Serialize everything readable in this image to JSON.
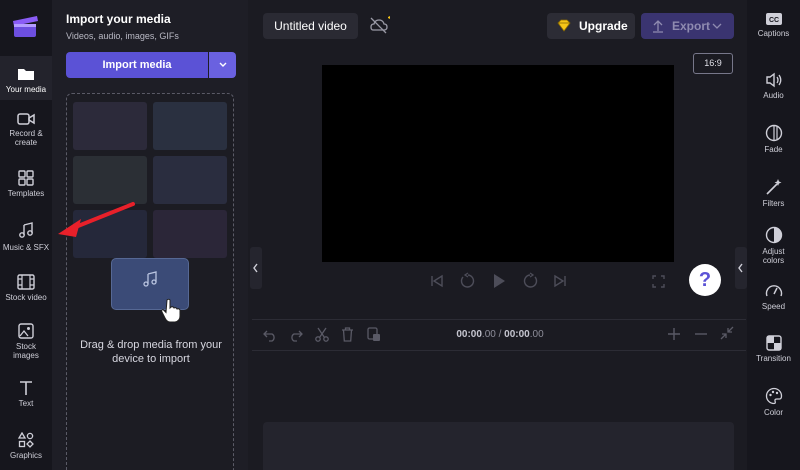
{
  "left_nav": {
    "items": [
      {
        "label": "Your media",
        "icon": "folder-icon",
        "active": true
      },
      {
        "label": "Record & create",
        "icon": "video-camera-icon"
      },
      {
        "label": "Templates",
        "icon": "templates-icon"
      },
      {
        "label": "Music & SFX",
        "icon": "music-note-icon"
      },
      {
        "label": "Stock video",
        "icon": "film-icon"
      },
      {
        "label": "Stock images",
        "icon": "image-icon"
      },
      {
        "label": "Text",
        "icon": "text-icon"
      },
      {
        "label": "Graphics",
        "icon": "shapes-icon"
      }
    ]
  },
  "media_panel": {
    "title": "Import your media",
    "subtitle": "Videos, audio, images, GIFs",
    "import_label": "Import media",
    "dropzone_text": "Drag & drop media from your device to import"
  },
  "toolbar": {
    "video_title": "Untitled video",
    "upgrade_label": "Upgrade",
    "export_label": "Export"
  },
  "preview": {
    "aspect_ratio": "16:9",
    "help_label": "?"
  },
  "timeline": {
    "current_time": "00:00",
    "current_frac": ".00",
    "separator": " / ",
    "total_time": "00:00",
    "total_frac": ".00"
  },
  "right_nav": {
    "items": [
      {
        "label": "Captions",
        "icon": "captions-icon"
      },
      {
        "label": "Audio",
        "icon": "speaker-icon"
      },
      {
        "label": "Fade",
        "icon": "fade-icon"
      },
      {
        "label": "Filters",
        "icon": "magic-wand-icon"
      },
      {
        "label": "Adjust colors",
        "icon": "half-circle-icon"
      },
      {
        "label": "Speed",
        "icon": "speedometer-icon"
      },
      {
        "label": "Transition",
        "icon": "transition-icon"
      },
      {
        "label": "Color",
        "icon": "palette-icon"
      }
    ]
  },
  "colors": {
    "accent": "#5b52d6",
    "annotation_arrow": "#e8202a",
    "upgrade_gem": "#f5c518"
  }
}
